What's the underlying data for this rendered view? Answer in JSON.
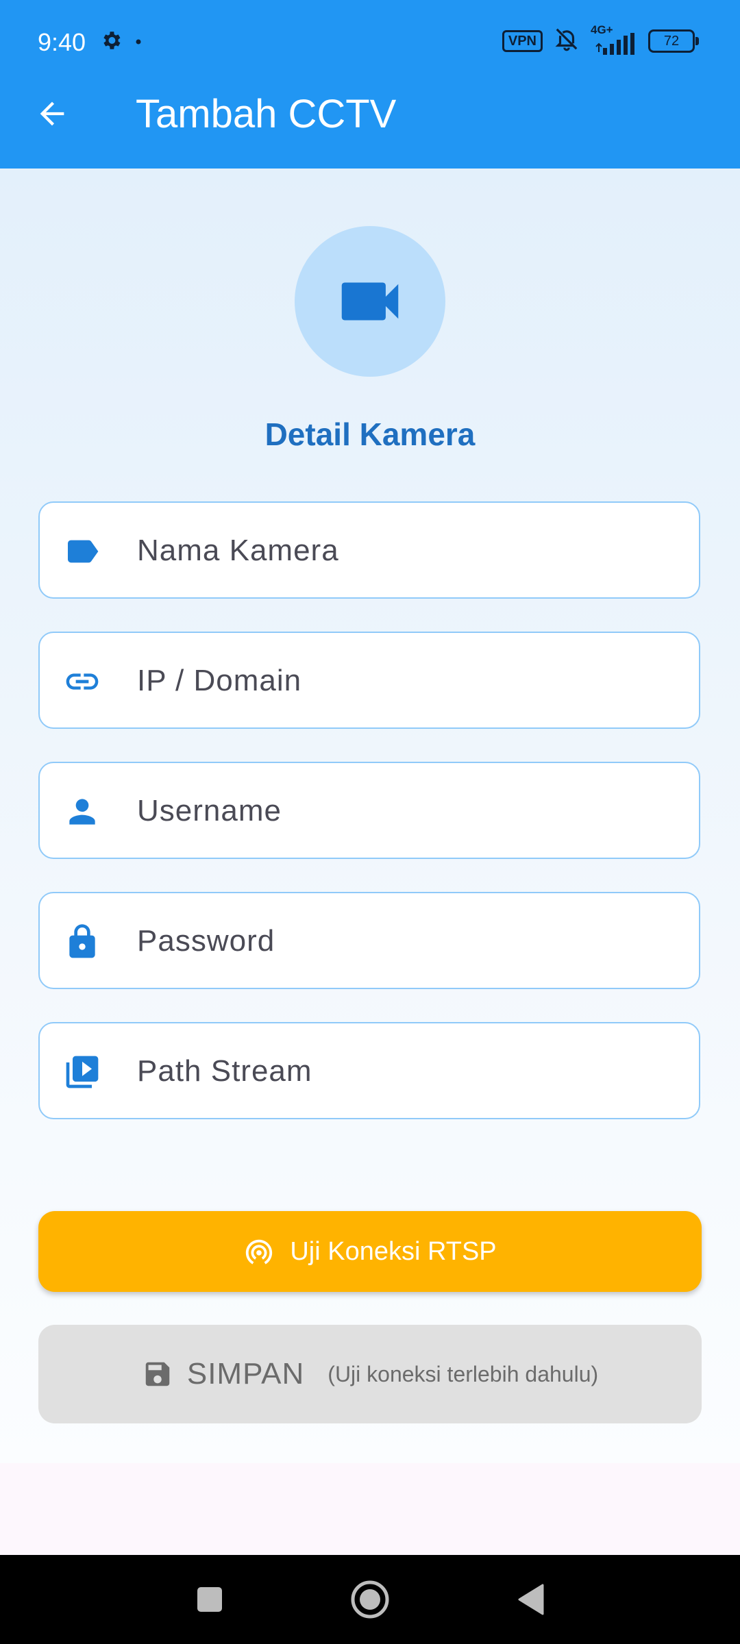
{
  "status_bar": {
    "time": "9:40",
    "vpn_label": "VPN",
    "network_label": "4G+",
    "battery_level": "72",
    "icons": [
      "settings-gear-icon",
      "notification-dot-icon",
      "bell-off-icon",
      "signal-icon"
    ]
  },
  "app_bar": {
    "title": "Tambah CCTV",
    "back_icon": "arrow-back-icon"
  },
  "form": {
    "header_icon": "videocam-icon",
    "section_title": "Detail Kamera",
    "fields": [
      {
        "icon": "label-tag-icon",
        "placeholder": "Nama Kamera",
        "value": ""
      },
      {
        "icon": "link-icon",
        "placeholder": "IP / Domain",
        "value": ""
      },
      {
        "icon": "person-icon",
        "placeholder": "Username",
        "value": ""
      },
      {
        "icon": "lock-icon",
        "placeholder": "Password",
        "value": ""
      },
      {
        "icon": "video-library-icon",
        "placeholder": "Path Stream",
        "value": ""
      }
    ]
  },
  "buttons": {
    "test": {
      "label": "Uji Koneksi RTSP",
      "icon": "wifi-tethering-icon",
      "color": "#FFB300"
    },
    "save": {
      "label": "SIMPAN",
      "hint": "(Uji koneksi terlebih dahulu)",
      "icon": "save-icon",
      "disabled": true,
      "color": "#E0E0E0"
    }
  },
  "colors": {
    "primary": "#2196F3",
    "accent_text": "#1F6FC0",
    "field_border": "#90CAF9",
    "avatar_bg": "#BBDEFB",
    "icon": "#1E7FD8"
  },
  "nav_bar": {
    "icons": [
      "recent-apps-icon",
      "home-icon",
      "back-triangle-icon"
    ]
  }
}
